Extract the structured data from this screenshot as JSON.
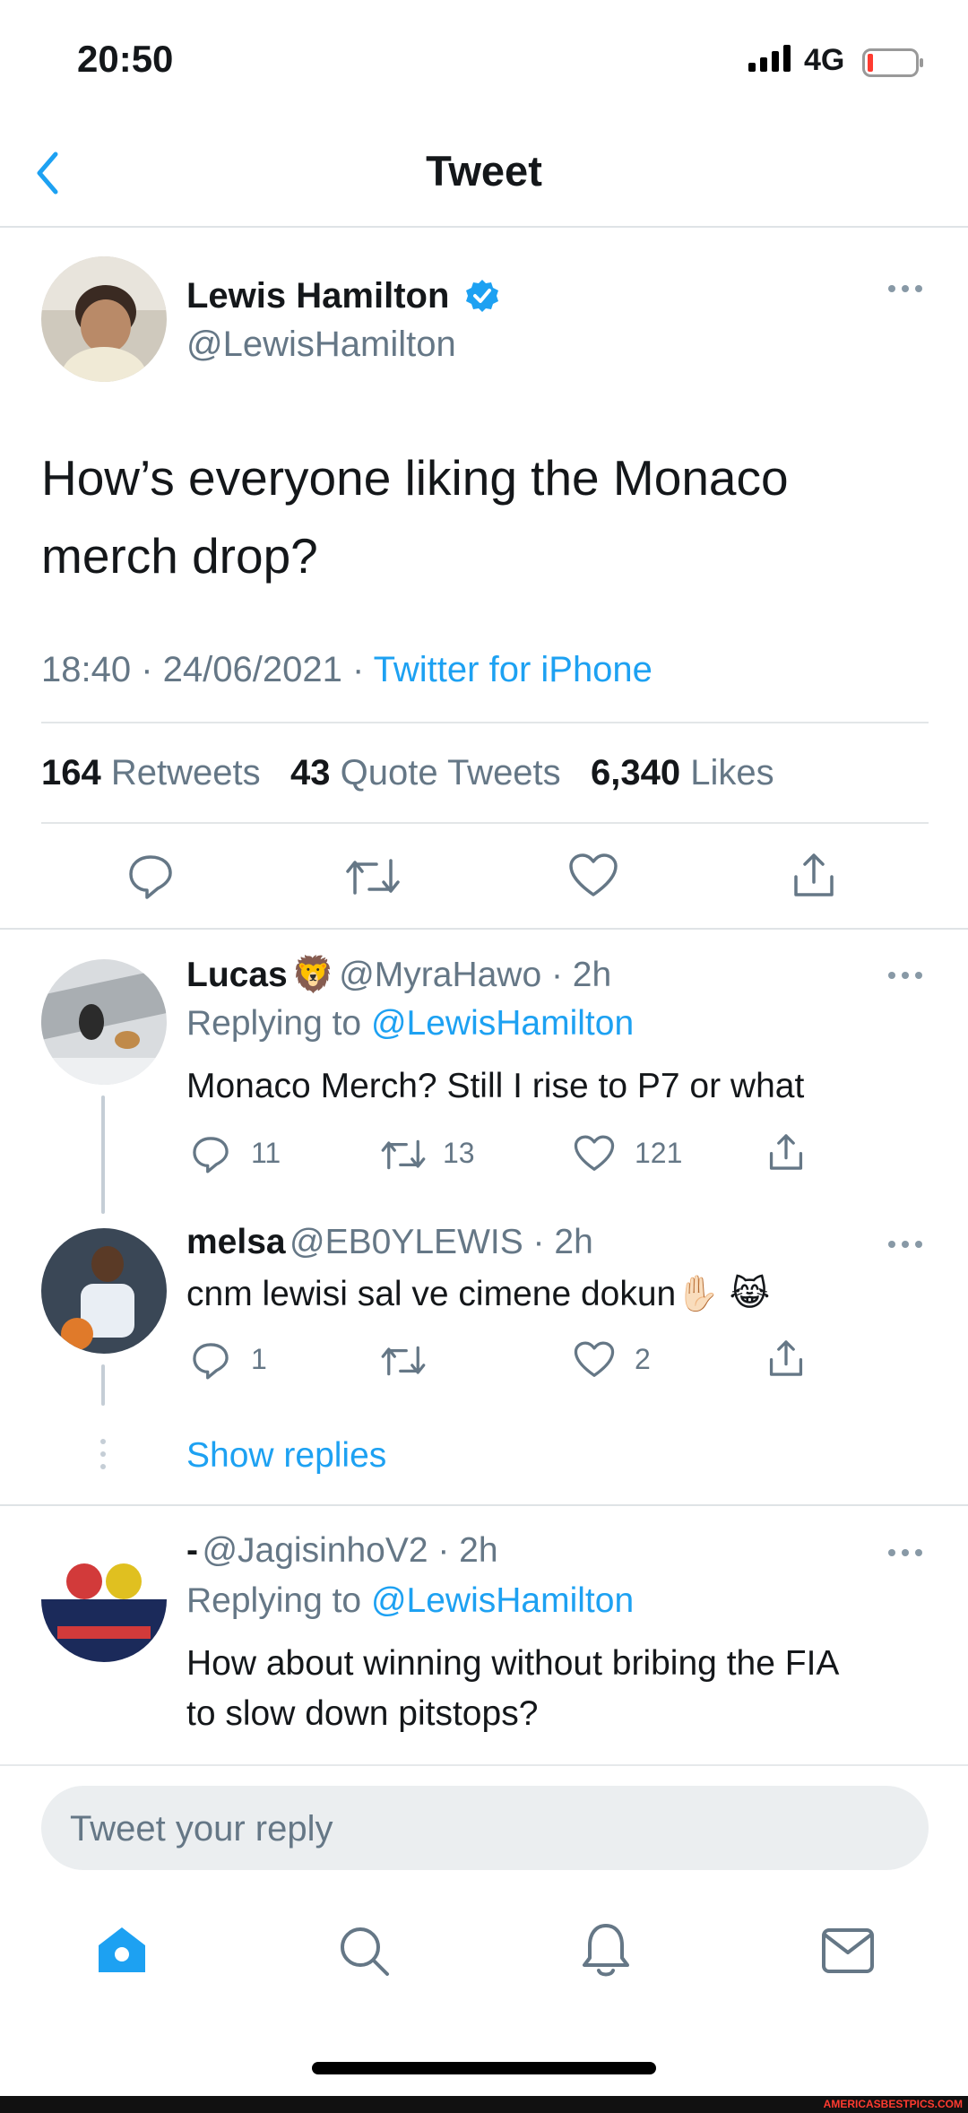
{
  "status_bar": {
    "time": "20:50",
    "network": "4G"
  },
  "header": {
    "title": "Tweet"
  },
  "tweet": {
    "author_name": "Lewis Hamilton",
    "author_handle": "@LewisHamilton",
    "text": "How’s everyone liking the Monaco merch drop?",
    "timestamp": "18:40 · 24/06/2021 · ",
    "source": "Twitter for iPhone",
    "retweets_count": "164",
    "retweets_label": "Retweets",
    "quotes_count": "43",
    "quotes_label": "Quote Tweets",
    "likes_count": "6,340",
    "likes_label": "Likes"
  },
  "replies": [
    {
      "name": "Lucas",
      "emoji": "🦁",
      "handle_time": "@MyraHawo · 2h",
      "replying_prefix": "Replying to ",
      "replying_to": "@LewisHamilton",
      "text": "Monaco Merch? Still I rise to P7 or what",
      "reply_count": "11",
      "retweet_count": "13",
      "like_count": "121"
    },
    {
      "name": "melsa",
      "handle_time": "@EB0YLEWIS · 2h",
      "text": "cnm lewisi sal ve cimene dokun",
      "emoji": "✋🏻 😹",
      "reply_count": "1",
      "retweet_count": "",
      "like_count": "2"
    },
    {
      "name": "-",
      "handle_time": "@JagisinhoV2 · 2h",
      "replying_prefix": "Replying to ",
      "replying_to": "@LewisHamilton",
      "text_line1": "How about winning without bribing the FIA",
      "text_line2": "to slow down pitstops?"
    }
  ],
  "show_replies": "Show replies",
  "reply_input": {
    "placeholder": "Tweet your reply"
  },
  "watermark": "AMERICASBESTPICS.COM",
  "colors": {
    "accent": "#1da1f2",
    "text": "#14171a",
    "secondary": "#657786"
  }
}
